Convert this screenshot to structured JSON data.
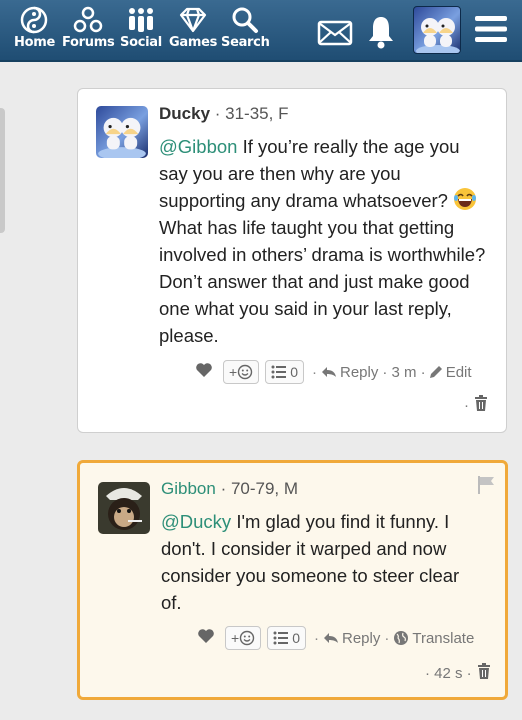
{
  "nav": {
    "items": [
      {
        "label": "Home",
        "icon": "yin-yang-icon"
      },
      {
        "label": "Forums",
        "icon": "people-icon"
      },
      {
        "label": "Social",
        "icon": "group-icon"
      },
      {
        "label": "Games",
        "icon": "diamond-icon"
      },
      {
        "label": "Search",
        "icon": "search-icon"
      }
    ]
  },
  "comments": [
    {
      "author": "Ducky",
      "meta": "· 31-35, F",
      "mention": "@Gibbon",
      "text_a": " If you’re really the age you say you are then why are you supporting any drama whatsoever? ",
      "text_b": " What has life taught you that getting involved in others’ drama is worthwhile? Don’t answer that and just make good one what you said in your last reply, please.",
      "react_label": "+",
      "count": "0",
      "reply": "Reply",
      "time": "· 3 m ·",
      "edit": "Edit",
      "trash_prefix": "·"
    },
    {
      "author": "Gibbon",
      "meta": "· 70-79, M",
      "mention": "@Ducky",
      "text": " I'm glad you find it funny. I don't. I consider it warped and now consider you someone to steer clear of.",
      "react_label": "+",
      "count": "0",
      "reply": "Reply",
      "sep": "·",
      "translate": "Translate",
      "time": "· 42 s ·"
    }
  ],
  "colors": {
    "accent": "#2d8f78",
    "highlight_border": "#f0a93a",
    "topbar": "#2b5b82"
  }
}
